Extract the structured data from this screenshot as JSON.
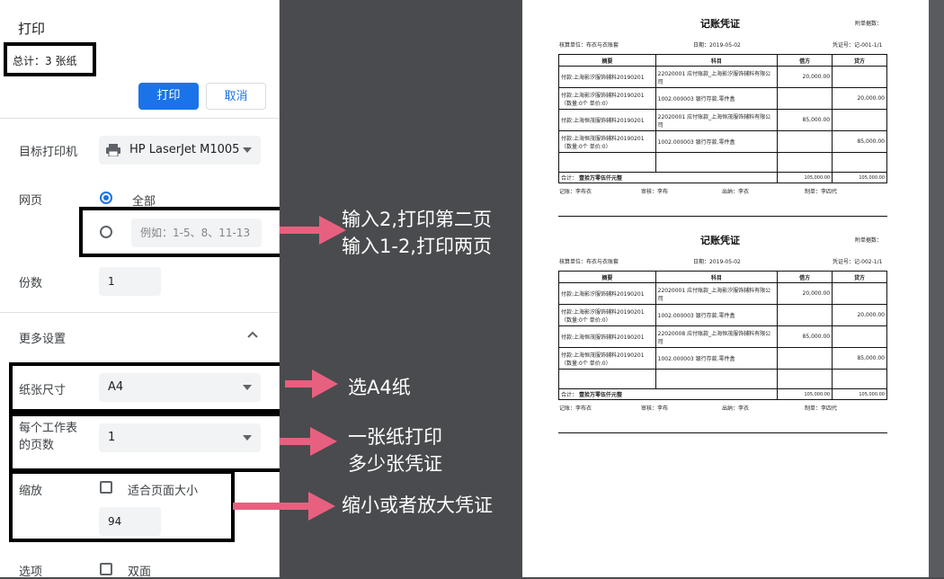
{
  "dialog": {
    "title": "打印",
    "total": "总计：3 张纸",
    "print_button": "打印",
    "cancel_button": "取消"
  },
  "settings": {
    "printer_label": "目标打印机",
    "printer_value": "HP LaserJet M1005",
    "pages_label": "网页",
    "pages_all": "全部",
    "pages_placeholder": "例如：1-5、8、11-13",
    "copies_label": "份数",
    "copies_value": "1",
    "more_settings": "更多设置",
    "paper_size_label": "纸张尺寸",
    "paper_size_value": "A4",
    "pages_per_sheet_label_1": "每个工作表",
    "pages_per_sheet_label_2": "的页数",
    "pages_per_sheet_value": "1",
    "scale_label": "缩放",
    "fit_to_page": "适合页面大小",
    "scale_value": "94",
    "options_label": "选项",
    "duplex": "双面"
  },
  "annotations": {
    "pages_line1": "输入2,打印第二页",
    "pages_line2": "输入1-2,打印两页",
    "paper": "选A4纸",
    "per_sheet_line1": "一张纸打印",
    "per_sheet_line2": "多少张凭证",
    "scale": "缩小或者放大凭证"
  },
  "colors": {
    "accent": "#1a73e8",
    "arrow": "#e8607f",
    "annotation_text": "#ffffff"
  },
  "vouchers": [
    {
      "title": "记账凭证",
      "attach": "附单据数：",
      "unit": "核算单位：布衣与衣账套",
      "date": "日期：2019-05-02",
      "number": "凭证号：记-001-1/1",
      "headers": [
        "摘要",
        "科目",
        "借方",
        "贷方"
      ],
      "rows": [
        [
          "付款:上海影汐服饰辅料20190201",
          "22020001 应付账款_上海影汐服饰辅料有限公司",
          "20,000.00",
          ""
        ],
        [
          "付款:上海影汐服饰辅料20190201（数量:0个 单价:0）",
          "1002.000003 银行存款.零件盒",
          "",
          "20,000.00"
        ],
        [
          "付款:上海恒茂服饰辅料20190201",
          "22020001 应付账款_上海恒茂服饰辅料有限公司",
          "85,000.00",
          ""
        ],
        [
          "付款:上海恒茂服饰辅料20190201（数量:0个 单价:0）",
          "1002.000003 银行存款.零件盒",
          "",
          "85,000.00"
        ],
        [
          "",
          "",
          "",
          ""
        ]
      ],
      "total_label": "合计：",
      "total_words": "壹拾万零伍仟元整",
      "total_debit": "105,000.00",
      "total_credit": "105,000.00",
      "signers": [
        "记账：李布衣",
        "审核：李布",
        "出纳：李衣",
        "制单：李四代"
      ]
    },
    {
      "title": "记账凭证",
      "attach": "附单据数：",
      "unit": "核算单位：布衣与衣账套",
      "date": "日期：2019-05-02",
      "number": "凭证号：记-002-1/1",
      "headers": [
        "摘要",
        "科目",
        "借方",
        "贷方"
      ],
      "rows": [
        [
          "付款:上海影汐服饰辅料20190201",
          "22020001 应付账款_上海影汐服饰辅料有限公司",
          "20,000.00",
          ""
        ],
        [
          "付款:上海影汐服饰辅料20190201（数量:0个 单价:0）",
          "1002.000003 银行存款.零件盒",
          "",
          "20,000.00"
        ],
        [
          "付款:上海恒茂服饰辅料20190201",
          "22020008 应付账款_上海恒茂服饰辅料有限公司",
          "85,000.00",
          ""
        ],
        [
          "付款:上海恒茂服饰辅料20190201（数量:0个 单价:0）",
          "1002.000003 银行存款.零件盒",
          "",
          "85,000.00"
        ],
        [
          "",
          "",
          "",
          ""
        ]
      ],
      "total_label": "合计：",
      "total_words": "壹拾万零伍仟元整",
      "total_debit": "105,000.00",
      "total_credit": "105,000.00",
      "signers": [
        "记账：李布衣",
        "审核：李布",
        "出纳：李衣",
        "制单：李四代"
      ]
    }
  ]
}
